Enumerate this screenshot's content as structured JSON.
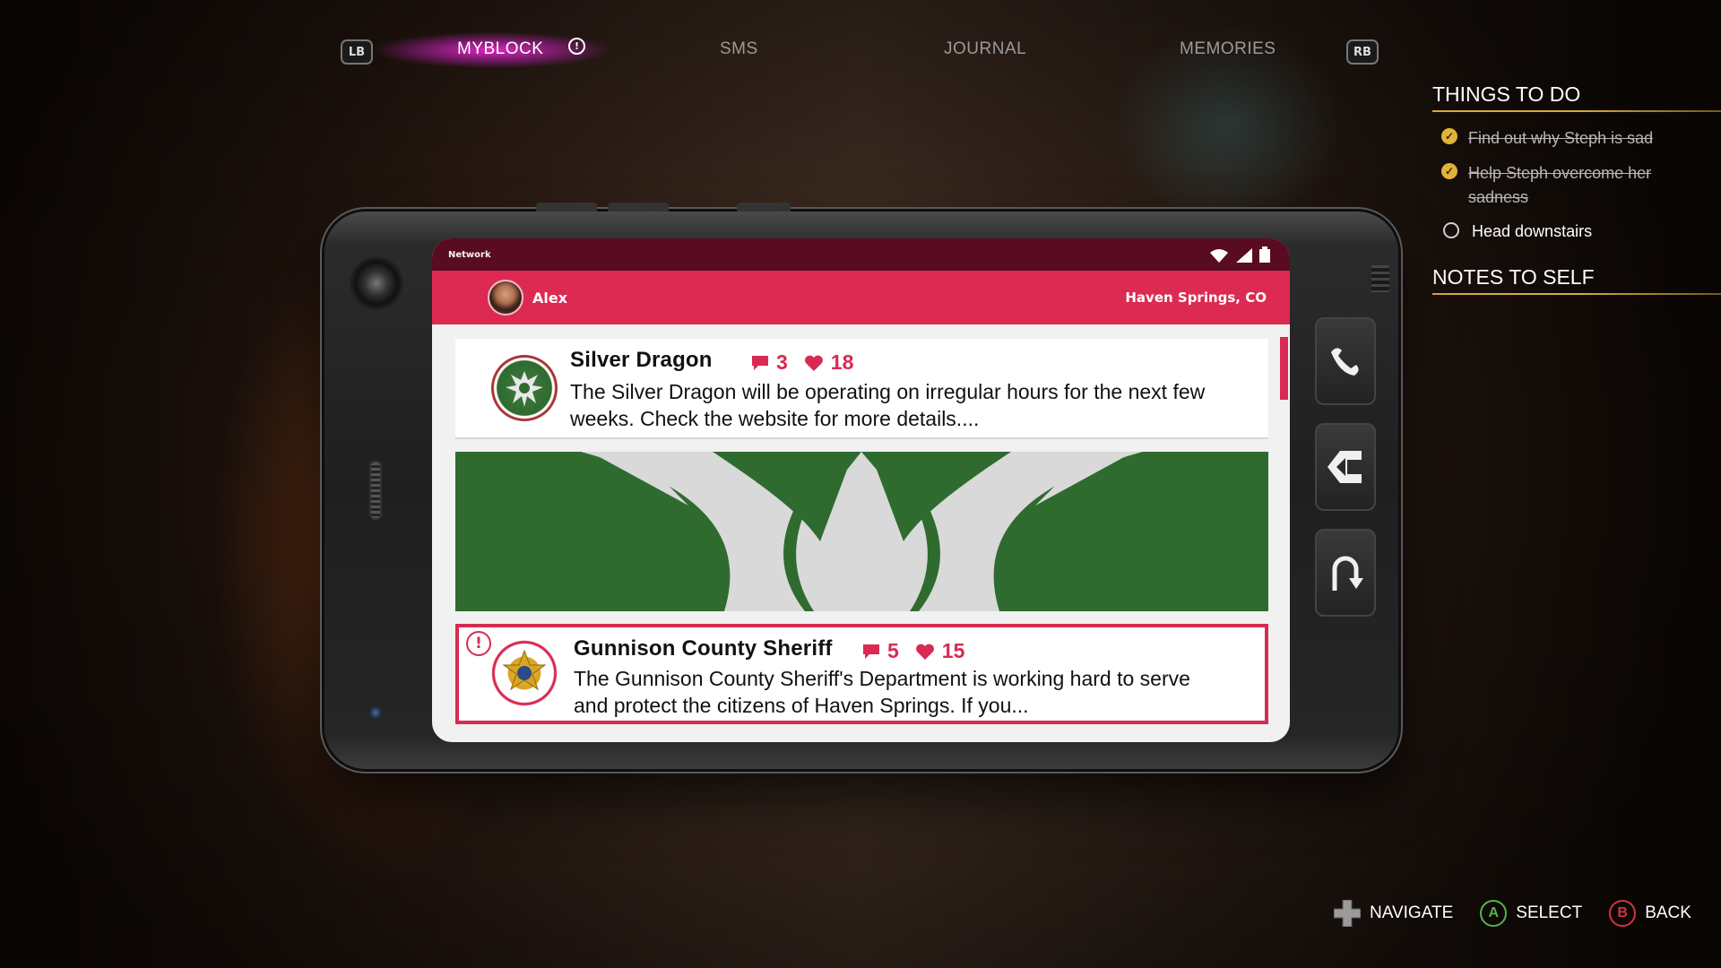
{
  "tabs": {
    "left_bumper": "LB",
    "right_bumper": "RB",
    "items": [
      {
        "label": "MYBLOCK",
        "active": true,
        "alert": true
      },
      {
        "label": "SMS",
        "active": false
      },
      {
        "label": "JOURNAL",
        "active": false
      },
      {
        "label": "MEMORIES",
        "active": false
      }
    ]
  },
  "objectives": {
    "things_to_do_title": "THINGS TO DO",
    "tasks": [
      {
        "text": "Find out why Steph is sad",
        "done": true
      },
      {
        "text": "Help Steph overcome her sadness",
        "done": true
      },
      {
        "text": "Head downstairs",
        "done": false
      }
    ],
    "notes_title": "NOTES TO SELF"
  },
  "phone": {
    "status_network": "Network",
    "user_name": "Alex",
    "location": "Haven Springs, CO",
    "posts": [
      {
        "title": "Silver Dragon",
        "comments": "3",
        "likes": "18",
        "body": "The Silver Dragon will be operating on irregular hours for the next few weeks. Check the website for more details....",
        "logo": "dragon-logo-icon"
      },
      {
        "title": "Gunnison County Sheriff",
        "comments": "5",
        "likes": "15",
        "body": "The Gunnison County Sheriff's Department is working hard to serve and protect the citizens of Haven Springs. If you...",
        "logo": "sheriff-badge-icon",
        "alert": true
      }
    ],
    "side_buttons": [
      "phone-call-icon",
      "back-arrow-icon",
      "return-icon"
    ]
  },
  "hints": {
    "navigate": "NAVIGATE",
    "select": "SELECT",
    "back": "BACK",
    "select_key": "A",
    "back_key": "B"
  },
  "colors": {
    "accent_pink": "#dc2a52",
    "status_bar": "#590b22",
    "objective_gold": "#e2b33a",
    "tab_glow": "#e628c8",
    "banner_green": "#2f6b2f"
  }
}
